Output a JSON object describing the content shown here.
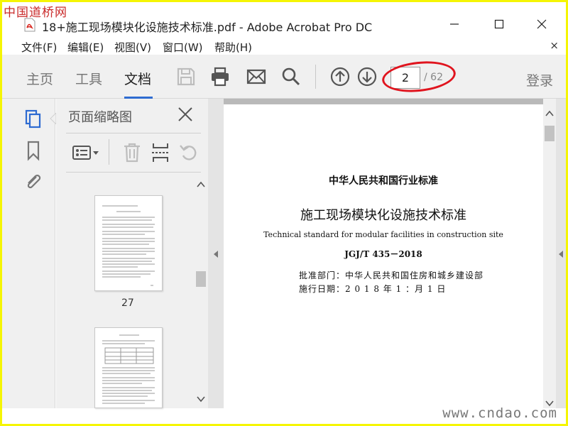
{
  "watermark_top": "中国道桥网",
  "watermark_bottom": "www.cndao.com",
  "window": {
    "title": "18+施工现场模块化设施技术标准.pdf - Adobe Acrobat Pro DC"
  },
  "menu": [
    "文件(F)",
    "编辑(E)",
    "视图(V)",
    "窗口(W)",
    "帮助(H)"
  ],
  "menu_close": "×",
  "tabs": {
    "home": "主页",
    "tools": "工具",
    "document": "文档"
  },
  "toolbar": {
    "icons": [
      "save-icon",
      "print-icon",
      "email-icon",
      "search-icon",
      "page-up-icon",
      "page-down-icon"
    ],
    "current_page": "2",
    "total_pages": "/ 62",
    "login": "登录"
  },
  "rail_icons": [
    "page-thumbnails-icon",
    "bookmark-icon",
    "attachment-icon"
  ],
  "thumbnail_panel": {
    "title": "页面缩略图",
    "icons": [
      "options-icon",
      "delete-icon",
      "insert-pages-icon",
      "rotate-icon"
    ],
    "page_label": "27"
  },
  "document": {
    "line1": "中华人民共和国行业标准",
    "line2": "施工现场模块化设施技术标准",
    "line3": "Technical standard for modular facilities in construction site",
    "line4": "JGJ/T 435－2018",
    "line5": "批准部门：中华人民共和国住房和城乡建设部",
    "line6": "施行日期：2 0 1 8 年 1 ：月 1 日"
  },
  "colors": {
    "frame": "#f5f505",
    "accent": "#2e6bd1",
    "annotation": "#e0141e"
  }
}
